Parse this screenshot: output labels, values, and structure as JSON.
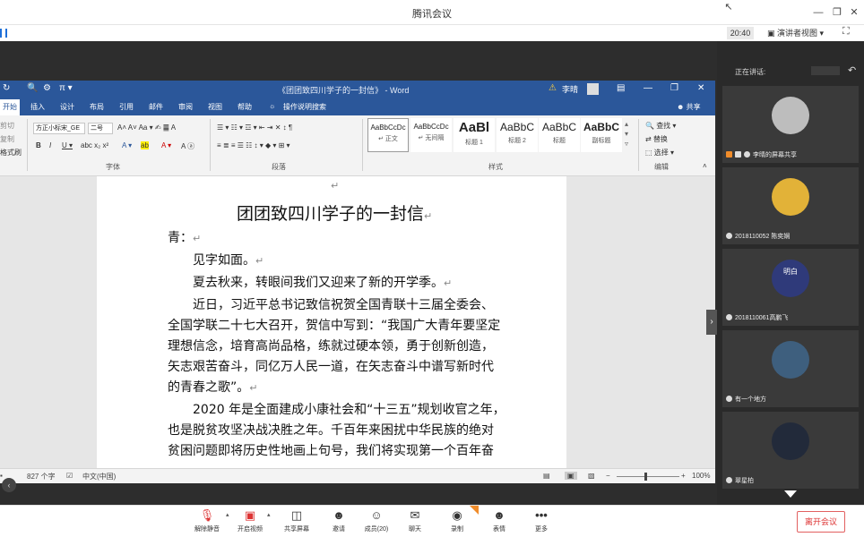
{
  "window": {
    "title": "腾讯会议"
  },
  "sharebar": {
    "time": "20:40",
    "presenter_view": "演讲者视图"
  },
  "word": {
    "doc_title": "《团团致四川学子的一封信》 - Word",
    "user": "李晴",
    "tabs": [
      "开始",
      "插入",
      "设计",
      "布局",
      "引用",
      "邮件",
      "审阅",
      "视图",
      "帮助"
    ],
    "tell_me": "操作说明搜索",
    "share": "共享",
    "clipboard": [
      "剪切",
      "复制",
      "格式刷"
    ],
    "font_name": "方正小标宋_GE",
    "font_size": "二号",
    "group_labels": {
      "font": "字体",
      "paragraph": "段落",
      "styles": "样式",
      "editing": "编辑"
    },
    "styles": [
      {
        "sample": "AaBbCcDc",
        "name": "正文"
      },
      {
        "sample": "AaBbCcDc",
        "name": "无间隔"
      },
      {
        "sample": "AaBl",
        "name": "标题 1"
      },
      {
        "sample": "AaBbC",
        "name": "标题 2"
      },
      {
        "sample": "AaBbC",
        "name": "标题"
      },
      {
        "sample": "AaBbC",
        "name": "副标题"
      }
    ],
    "editing": [
      "查找",
      "替换",
      "选择"
    ],
    "doc": {
      "title": "团团致四川学子的一封信",
      "salutation": "青：",
      "lines": [
        "见字如面。",
        "夏去秋来，转眼间我们又迎来了新的开学季。",
        "近日，习近平总书记致信祝贺全国青联十三届全委会、",
        "全国学联二十七大召开，贺信中写到：“我国广大青年要坚定",
        "理想信念，培育高尚品格，练就过硬本领，勇于创新创造，",
        "矢志艰苦奋斗，同亿万人民一道，在矢志奋斗中谱写新时代",
        "的青春之歌”。",
        "2020 年是全面建成小康社会和“十三五”规划收官之年，",
        "也是脱贫攻坚决战决胜之年。千百年来困扰中华民族的绝对",
        "贫困问题即将历史性地画上句号，我们将实现第一个百年奋"
      ]
    },
    "status": {
      "words": "827 个字",
      "language": "中文(中国)",
      "zoom": "100%"
    }
  },
  "panel": {
    "speaking_label": "正在讲话:",
    "participants": [
      {
        "name": "李晴的屏幕共享"
      },
      {
        "name": "2018110052 陈奕娴"
      },
      {
        "name": "2018110061高鹏飞",
        "avatar_text": "明白"
      },
      {
        "name": "有一个地方"
      },
      {
        "name": "翠星柏"
      }
    ]
  },
  "bottombar": {
    "buttons": [
      {
        "label": "解除静音",
        "icon": "mic-muted-icon"
      },
      {
        "label": "开启视频",
        "icon": "camera-off-icon"
      },
      {
        "label": "共享屏幕",
        "icon": "share-screen-icon"
      },
      {
        "label": "邀请",
        "icon": "invite-icon"
      },
      {
        "label": "成员(20)",
        "icon": "members-icon"
      },
      {
        "label": "聊天",
        "icon": "chat-icon"
      },
      {
        "label": "录制",
        "icon": "record-icon"
      },
      {
        "label": "表情",
        "icon": "emoji-icon"
      },
      {
        "label": "更多",
        "icon": "more-icon"
      }
    ],
    "leave": "离开会议"
  },
  "colors": {
    "word_blue": "#2b579a",
    "leave_red": "#d33333",
    "panel_bg": "#2a2a2a"
  }
}
